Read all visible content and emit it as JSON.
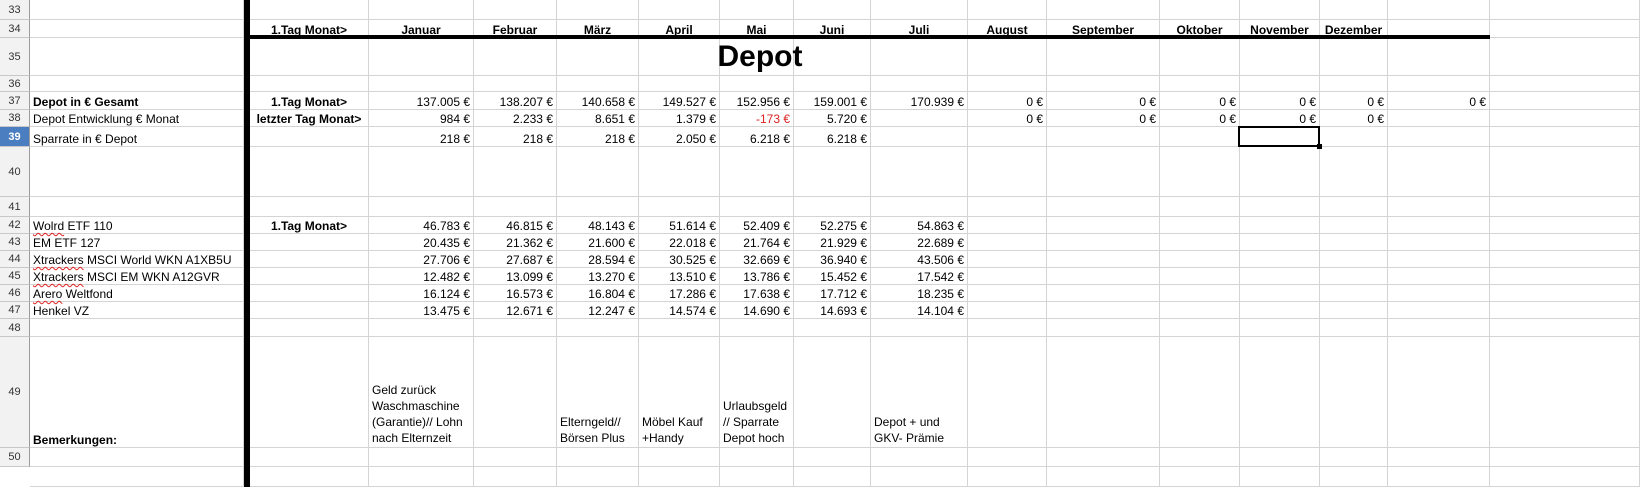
{
  "row_numbers": [
    "33",
    "34",
    "35",
    "36",
    "37",
    "38",
    "39",
    "40",
    "41",
    "42",
    "43",
    "44",
    "45",
    "46",
    "47",
    "48",
    "49",
    "50"
  ],
  "selected_row": "39",
  "header_row": {
    "first": "1.Tag Monat>",
    "months": [
      "Januar",
      "Februar",
      "März",
      "April",
      "Mai",
      "Juni",
      "Juli",
      "August",
      "September",
      "Oktober",
      "November",
      "Dezember"
    ]
  },
  "title": "Depot",
  "summary_rows": [
    {
      "label": "Depot in € Gesamt",
      "marker": "1.Tag Monat>",
      "values": [
        "137.005 €",
        "138.207 €",
        "140.658 €",
        "149.527 €",
        "152.956 €",
        "159.001 €",
        "170.939 €",
        "0 €",
        "0 €",
        "0 €",
        "0 €",
        "0 €",
        "0 €"
      ]
    },
    {
      "label": "Depot Entwicklung € Monat",
      "marker": "letzter Tag Monat>",
      "values": [
        "984 €",
        "2.233 €",
        "8.651 €",
        "1.379 €",
        "-173 €",
        "5.720 €",
        "",
        "0 €",
        "0 €",
        "0 €",
        "0 €",
        "0 €",
        ""
      ]
    },
    {
      "label": "Sparrate in € Depot",
      "marker": "",
      "values": [
        "218 €",
        "218 €",
        "218 €",
        "2.050 €",
        "6.218 €",
        "6.218 €",
        "",
        "",
        "",
        "",
        "",
        "",
        ""
      ]
    }
  ],
  "positions_marker": "1.Tag Monat>",
  "positions": [
    {
      "name": "Wolrd ETF 110",
      "values": [
        "46.783 €",
        "46.815 €",
        "48.143 €",
        "51.614 €",
        "52.409 €",
        "52.275 €",
        "54.863 €"
      ]
    },
    {
      "name": "EM ETF 127",
      "values": [
        "20.435 €",
        "21.362 €",
        "21.600 €",
        "22.018 €",
        "21.764 €",
        "21.929 €",
        "22.689 €"
      ]
    },
    {
      "name": "Xtrackers MSCI World WKN A1XB5U",
      "values": [
        "27.706 €",
        "27.687 €",
        "28.594 €",
        "30.525 €",
        "32.669 €",
        "36.940 €",
        "43.506 €"
      ]
    },
    {
      "name": "Xtrackers MSCI EM WKN A12GVR",
      "values": [
        "12.482 €",
        "13.099 €",
        "13.270 €",
        "13.510 €",
        "13.786 €",
        "15.452 €",
        "17.542 €"
      ]
    },
    {
      "name": "Arero Weltfond",
      "values": [
        "16.124 €",
        "16.573 €",
        "16.804 €",
        "17.286 €",
        "17.638 €",
        "17.712 €",
        "18.235 €"
      ]
    },
    {
      "name": "Henkel VZ",
      "values": [
        "13.475 €",
        "12.671 €",
        "12.247 €",
        "14.574 €",
        "14.690 €",
        "14.693 €",
        "14.104 €"
      ]
    }
  ],
  "remarks_label": "Bemerkungen:",
  "remarks": [
    "Geld zurück Waschmaschine (Garantie)// Lohn nach Elternzeit",
    "",
    "Elterngeld// Börsen Plus",
    "Möbel Kauf +Handy",
    "Urlaubsgeld // Sparrate Depot hoch",
    "",
    "Depot + und GKV- Prämie"
  ],
  "colors": {
    "negative": "#dd2222",
    "selected_row_header": "#4a7ec0",
    "grid": "#d4d4d4"
  }
}
